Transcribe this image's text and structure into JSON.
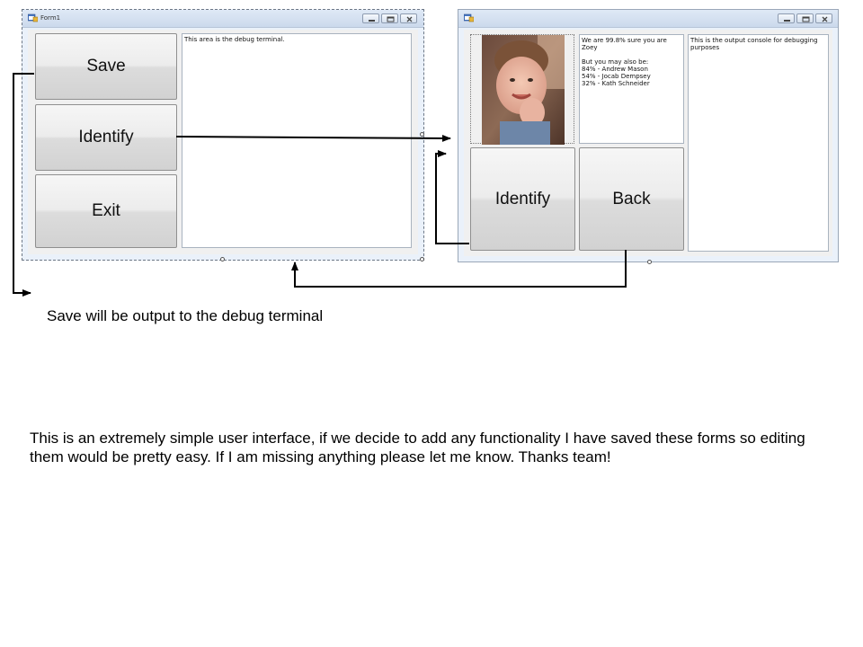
{
  "form1": {
    "title": "Form1",
    "buttons": {
      "save": "Save",
      "identify": "Identify",
      "exit": "Exit"
    },
    "debug_terminal_text": "This area is the debug terminal."
  },
  "form2": {
    "title": "",
    "result_text": "We are 99.8% sure you are Zoey\n\nBut you may also be:\n84% - Andrew Mason\n54% - Jocab Dempsey\n32% - Kath Schneider",
    "output_console_text": "This is the output console for debugging purposes",
    "buttons": {
      "identify": "Identify",
      "back": "Back"
    }
  },
  "notes": {
    "save_note": "Save will be output to the debug terminal",
    "summary": "This is an extremely simple user interface, if we decide to add any functionality I have saved these forms so editing them would be pretty easy.  If I am missing anything please let me know.  Thanks team!"
  },
  "icons": {
    "window_app": "form-icon",
    "minimize": "minimize-icon",
    "maximize": "maximize-icon",
    "close": "close-icon"
  },
  "colors": {
    "arrow": "#000000",
    "window_chrome": "#dfe9f6"
  }
}
